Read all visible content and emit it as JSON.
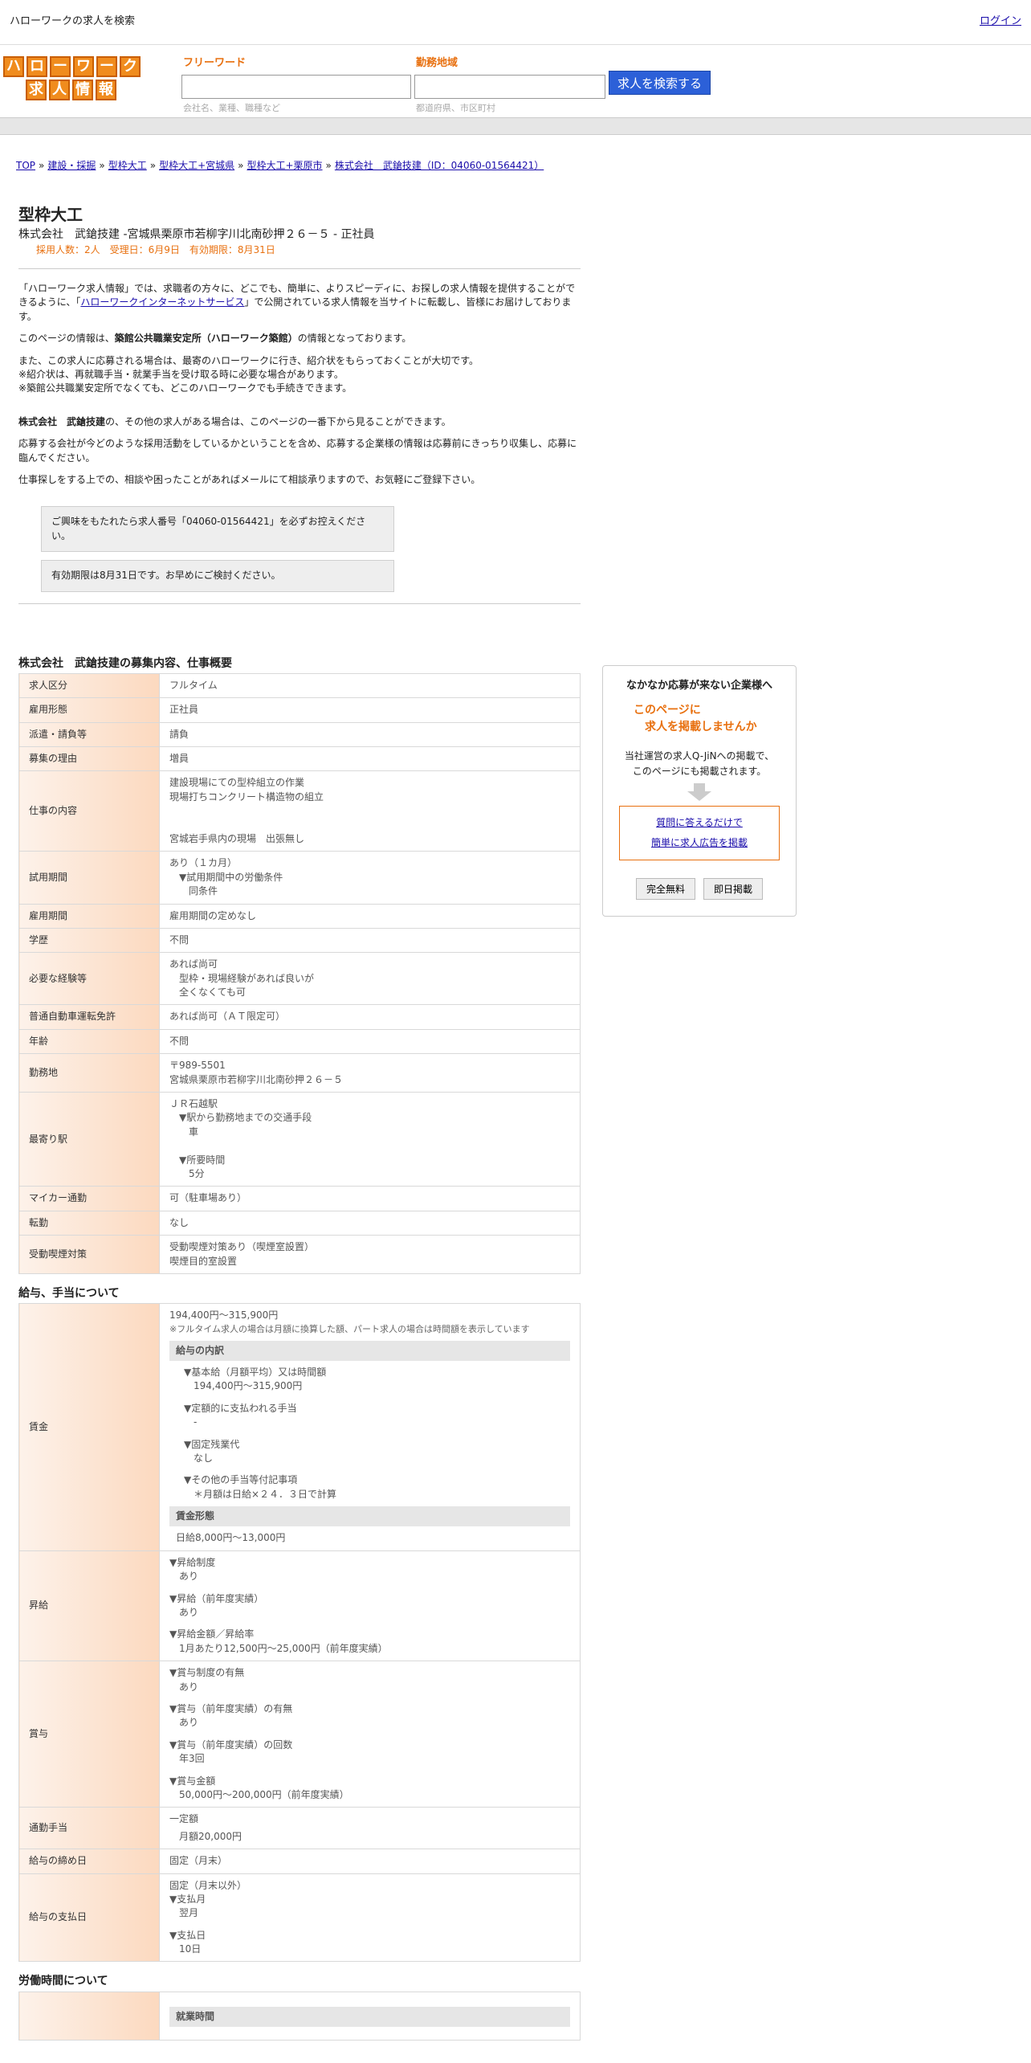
{
  "topbar": {
    "site_name": "ハローワークの求人を検索",
    "login": "ログイン"
  },
  "logo": {
    "row1": [
      "ハ",
      "ロ",
      "ー",
      "ワ",
      "ー",
      "ク"
    ],
    "row2": [
      "求",
      "人",
      "情",
      "報"
    ]
  },
  "search": {
    "freeword_label": "フリーワード",
    "freeword_placeholder": "",
    "freeword_hint": "会社名、業種、職種など",
    "area_label": "勤務地域",
    "area_hint": "都道府県、市区町村",
    "button": "求人を検索する"
  },
  "breadcrumb": [
    {
      "label": "TOP",
      "link": true
    },
    {
      "label": "建設・採掘",
      "link": true
    },
    {
      "label": "型枠大工",
      "link": true
    },
    {
      "label": "型枠大工+宮城県",
      "link": true
    },
    {
      "label": "型枠大工+栗原市",
      "link": true
    },
    {
      "label": "株式会社　武鎗技建（ID：04060-01564421）",
      "link": true
    }
  ],
  "job": {
    "title": "型枠大工",
    "company_line": "株式会社　武鎗技建 -宮城県栗原市若柳字川北南砂押２６－５ - 正社員",
    "meta": "採用人数：2人　受理日：6月9日　有効期限：8月31日"
  },
  "intro": {
    "p1_before": "「ハローワーク求人情報」では、求職者の方々に、どこでも、簡単に、よりスピーディに、お探しの求人情報を提供することができるように、「",
    "p1_link": "ハローワークインターネットサービス",
    "p1_after": "」で公開されている求人情報を当サイトに転載し、皆様にお届けしております。",
    "p2_before": "このページの情報は、",
    "p2_bold": "築館公共職業安定所（ハローワーク築館）",
    "p2_after": "の情報となっております。",
    "p3_l1": "また、この求人に応募される場合は、最寄のハローワークに行き、紹介状をもらっておくことが大切です。",
    "p3_l2": "※紹介状は、再就職手当・就業手当を受け取る時に必要な場合があります。",
    "p3_l3": "※築館公共職業安定所でなくても、どこのハローワークでも手続きできます。",
    "p4_bold": "株式会社　武鎗技建",
    "p4_after": "の、その他の求人がある場合は、このページの一番下から見ることができます。",
    "p5": "応募する会社が今どのような採用活動をしているかということを含め、応募する企業様の情報は応募前にきっちり収集し、応募に臨んでください。",
    "p6": "仕事探しをする上での、相談や困ったことがあればメールにて相談承りますので、お気軽にご登録下さい。"
  },
  "notices": {
    "n1": "ご興味をもたれたら求人番号「04060-01564421」を必ずお控えください。",
    "n2": "有効期限は8月31日です。お早めにご検討ください。"
  },
  "overview": {
    "title": "株式会社　武鎗技建の募集内容、仕事概要",
    "rows": [
      {
        "label": "求人区分",
        "lines": [
          "フルタイム"
        ]
      },
      {
        "label": "雇用形態",
        "lines": [
          "正社員"
        ]
      },
      {
        "label": "派遣・請負等",
        "lines": [
          "請負"
        ]
      },
      {
        "label": "募集の理由",
        "lines": [
          "増員"
        ]
      },
      {
        "label": "仕事の内容",
        "lines": [
          "建設現場にての型枠組立の作業",
          "現場打ちコンクリート構造物の組立",
          " ",
          " ",
          "宮城岩手県内の現場　出張無し"
        ]
      },
      {
        "label": "試用期間",
        "lines": [
          "あり（１カ月）",
          "　▼試用期間中の労働条件",
          "　　同条件"
        ]
      },
      {
        "label": "雇用期間",
        "lines": [
          "雇用期間の定めなし"
        ]
      },
      {
        "label": "学歴",
        "lines": [
          "不問"
        ]
      },
      {
        "label": "必要な経験等",
        "lines": [
          "あれば尚可",
          "　型枠・現場経験があれば良いが",
          "　全くなくても可"
        ]
      },
      {
        "label": "普通自動車運転免許",
        "lines": [
          "あれば尚可（ＡＴ限定可）"
        ]
      },
      {
        "label": "年齢",
        "lines": [
          "不問"
        ]
      },
      {
        "label": "勤務地",
        "lines": [
          "〒989-5501",
          "宮城県栗原市若柳字川北南砂押２６－５"
        ]
      },
      {
        "label": "最寄り駅",
        "lines": [
          "ＪＲ石越駅",
          "　▼駅から勤務地までの交通手段",
          "　　車",
          " ",
          "　▼所要時間",
          "　　5分"
        ]
      },
      {
        "label": "マイカー通勤",
        "lines": [
          "可（駐車場あり）"
        ]
      },
      {
        "label": "転勤",
        "lines": [
          "なし"
        ]
      },
      {
        "label": "受動喫煙対策",
        "lines": [
          "受動喫煙対策あり（喫煙室設置）",
          "喫煙目的室設置"
        ]
      }
    ]
  },
  "salary": {
    "title": "給与、手当について",
    "wage_label": "賃金",
    "wage_range": "194,400円〜315,900円",
    "wage_note": "※フルタイム求人の場合は月額に換算した額、パート求人の場合は時間額を表示しています",
    "breakdown_head": "給与の内訳",
    "b1_head": "▼基本給（月額平均）又は時間額",
    "b1_val": "194,400円〜315,900円",
    "b2_head": "▼定額的に支払われる手当",
    "b2_val": "-",
    "b3_head": "▼固定残業代",
    "b3_val": "なし",
    "b4_head": "▼その他の手当等付記事項",
    "b4_val": "＊月額は日給×２４．３日で計算",
    "form_head": "賃金形態",
    "form_val": "日給8,000円〜13,000円",
    "rows": [
      {
        "label": "昇給",
        "groups": [
          [
            "▼昇給制度",
            "あり"
          ],
          [
            "▼昇給（前年度実績）",
            "あり"
          ],
          [
            "▼昇給金額／昇給率",
            "1月あたり12,500円〜25,000円（前年度実績）"
          ]
        ]
      },
      {
        "label": "賞与",
        "groups": [
          [
            "▼賞与制度の有無",
            "あり"
          ],
          [
            "▼賞与（前年度実績）の有無",
            "あり"
          ],
          [
            "▼賞与（前年度実績）の回数",
            "年3回"
          ],
          [
            "▼賞与金額",
            "50,000円〜200,000円（前年度実績）"
          ]
        ]
      }
    ],
    "commute_label": "通勤手当",
    "commute_l1": "一定額",
    "commute_l2": "月額20,000円",
    "closing_label": "給与の締め日",
    "closing_val": "固定（月末）",
    "payday_label": "給与の支払日",
    "payday_l1": "固定（月末以外）",
    "payday_l2": "▼支払月",
    "payday_l3": "翌月",
    "payday_l4": "▼支払日",
    "payday_l5": "10日"
  },
  "hours": {
    "title": "労働時間について",
    "first_head": "就業時間"
  },
  "ad": {
    "title": "なかなか応募が来ない企業様へ",
    "orange_l1": "このページに",
    "orange_l2": "求人を掲載しませんか",
    "text_l1": "当社運営の求人Q-JiNへの掲載で、",
    "text_l2": "このページにも掲載されます。",
    "link1": "質問に答えるだけで",
    "link2": "簡単に求人広告を掲載",
    "btn1": "完全無料",
    "btn2": "即日掲載",
    "arrow_color": "#cccccc"
  }
}
